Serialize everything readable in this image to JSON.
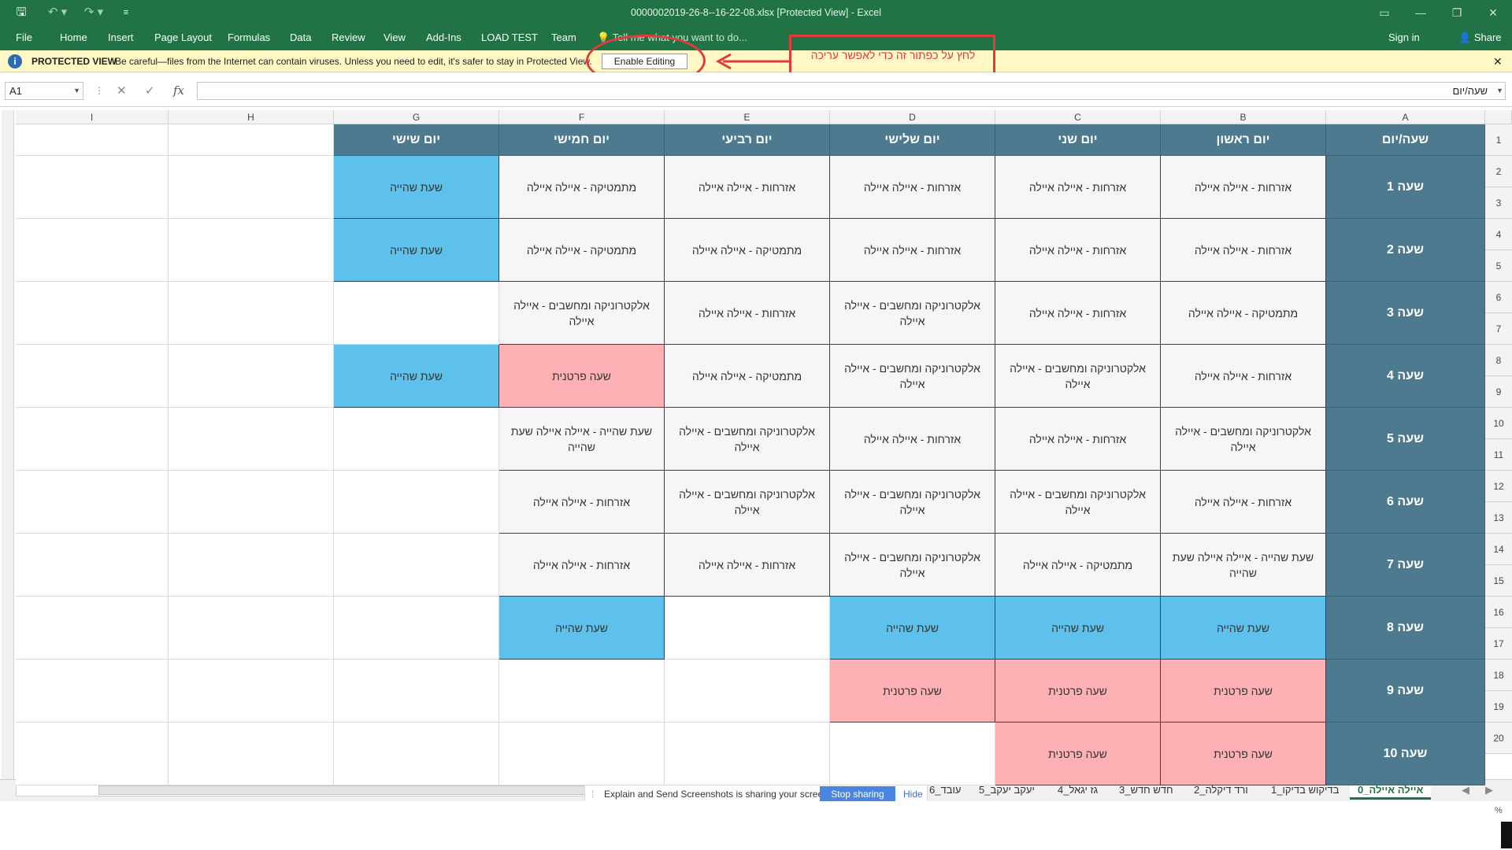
{
  "window": {
    "title": "0000002019-26-8--16-22-08.xlsx  [Protected View] - Excel",
    "controls": [
      "▭",
      "—",
      "❐",
      "✕"
    ]
  },
  "quick_access": {
    "save_icon": "save-icon",
    "undo_icon": "undo-icon",
    "redo_icon": "redo-icon",
    "customize_icon": "customize-icon"
  },
  "ribbon": {
    "tabs": [
      "File",
      "Home",
      "Insert",
      "Page Layout",
      "Formulas",
      "Data",
      "Review",
      "View",
      "Add-Ins",
      "LOAD TEST",
      "Team"
    ],
    "tell_me": "Tell me what you want to do...",
    "sign_in": "Sign in",
    "share": "Share"
  },
  "protected_view": {
    "title": "PROTECTED VIEW",
    "message": "Be careful—files from the Internet can contain viruses. Unless you need to edit, it's safer to stay in Protected View.",
    "enable_button": "Enable Editing",
    "close": "✕",
    "annotation": "לחץ על כפתור זה כדי לאפשר עריכה"
  },
  "formula_bar": {
    "name_box": "A1",
    "formula_value": "שעה/יום",
    "fx": "fx",
    "cancel": "✕",
    "enter": "✓"
  },
  "grid": {
    "column_letters": [
      "A",
      "B",
      "C",
      "D",
      "E",
      "F",
      "G",
      "H",
      "I"
    ],
    "row_numbers": [
      "1",
      "2",
      "3",
      "4",
      "5",
      "6",
      "7",
      "8",
      "9",
      "10",
      "11",
      "12",
      "13",
      "14",
      "15",
      "16",
      "17",
      "18",
      "19",
      "20"
    ],
    "headers": [
      "שעה/יום",
      "יום ראשון",
      "יום שני",
      "יום שלישי",
      "יום רביעי",
      "יום חמישי",
      "יום שישי"
    ],
    "periods": [
      {
        "time": "שעה 1",
        "cells": [
          {
            "text": "אזרחות - איילה איילה",
            "style": "norm"
          },
          {
            "text": "אזרחות - איילה איילה",
            "style": "norm"
          },
          {
            "text": "אזרחות - איילה איילה",
            "style": "norm"
          },
          {
            "text": "אזרחות - איילה איילה",
            "style": "norm"
          },
          {
            "text": "מתמטיקה - איילה איילה",
            "style": "norm"
          },
          {
            "text": "שעת שהייה",
            "style": "blue"
          }
        ]
      },
      {
        "time": "שעה 2",
        "cells": [
          {
            "text": "אזרחות - איילה איילה",
            "style": "norm"
          },
          {
            "text": "אזרחות - איילה איילה",
            "style": "norm"
          },
          {
            "text": "אזרחות - איילה איילה",
            "style": "norm"
          },
          {
            "text": "מתמטיקה - איילה איילה",
            "style": "norm"
          },
          {
            "text": "מתמטיקה - איילה איילה",
            "style": "norm"
          },
          {
            "text": "שעת שהייה",
            "style": "blue"
          }
        ]
      },
      {
        "time": "שעה 3",
        "cells": [
          {
            "text": "מתמטיקה - איילה איילה",
            "style": "norm"
          },
          {
            "text": "אזרחות - איילה איילה",
            "style": "norm"
          },
          {
            "text": "אלקטרוניקה ומחשבים - איילה איילה",
            "style": "norm"
          },
          {
            "text": "אזרחות - איילה איילה",
            "style": "norm"
          },
          {
            "text": "אלקטרוניקה ומחשבים - איילה איילה",
            "style": "norm"
          },
          {
            "text": "",
            "style": "empty"
          }
        ]
      },
      {
        "time": "שעה 4",
        "cells": [
          {
            "text": "אזרחות - איילה איילה",
            "style": "norm"
          },
          {
            "text": "אלקטרוניקה ומחשבים - איילה איילה",
            "style": "norm"
          },
          {
            "text": "אלקטרוניקה ומחשבים - איילה איילה",
            "style": "norm"
          },
          {
            "text": "מתמטיקה - איילה איילה",
            "style": "norm"
          },
          {
            "text": "שעה פרטנית",
            "style": "pink"
          },
          {
            "text": "שעת שהייה",
            "style": "blue"
          }
        ]
      },
      {
        "time": "שעה 5",
        "cells": [
          {
            "text": "אלקטרוניקה ומחשבים - איילה איילה",
            "style": "norm"
          },
          {
            "text": "אזרחות - איילה איילה",
            "style": "norm"
          },
          {
            "text": "אזרחות - איילה איילה",
            "style": "norm"
          },
          {
            "text": "אלקטרוניקה ומחשבים - איילה איילה",
            "style": "norm"
          },
          {
            "text": "שעת שהייה - איילה איילה שעת שהייה",
            "style": "norm"
          },
          {
            "text": "",
            "style": "empty"
          }
        ]
      },
      {
        "time": "שעה 6",
        "cells": [
          {
            "text": "אזרחות - איילה איילה",
            "style": "norm"
          },
          {
            "text": "אלקטרוניקה ומחשבים - איילה איילה",
            "style": "norm"
          },
          {
            "text": "אלקטרוניקה ומחשבים - איילה איילה",
            "style": "norm"
          },
          {
            "text": "אלקטרוניקה ומחשבים - איילה איילה",
            "style": "norm"
          },
          {
            "text": "אזרחות - איילה איילה",
            "style": "norm"
          },
          {
            "text": "",
            "style": "empty"
          }
        ]
      },
      {
        "time": "שעה 7",
        "cells": [
          {
            "text": "שעת שהייה - איילה איילה שעת שהייה",
            "style": "norm"
          },
          {
            "text": "מתמטיקה - איילה איילה",
            "style": "norm"
          },
          {
            "text": "אלקטרוניקה ומחשבים - איילה איילה",
            "style": "norm"
          },
          {
            "text": "אזרחות - איילה איילה",
            "style": "norm"
          },
          {
            "text": "אזרחות - איילה איילה",
            "style": "norm"
          },
          {
            "text": "",
            "style": "empty"
          }
        ]
      },
      {
        "time": "שעה 8",
        "cells": [
          {
            "text": "שעת שהייה",
            "style": "blue"
          },
          {
            "text": "שעת שהייה",
            "style": "blue"
          },
          {
            "text": "שעת שהייה",
            "style": "blue"
          },
          {
            "text": "",
            "style": "empty"
          },
          {
            "text": "שעת שהייה",
            "style": "blue"
          },
          {
            "text": "",
            "style": "empty"
          }
        ]
      },
      {
        "time": "שעה 9",
        "cells": [
          {
            "text": "שעה פרטנית",
            "style": "pink"
          },
          {
            "text": "שעה פרטנית",
            "style": "pink"
          },
          {
            "text": "שעה פרטנית",
            "style": "pink"
          },
          {
            "text": "",
            "style": "empty"
          },
          {
            "text": "",
            "style": "empty"
          },
          {
            "text": "",
            "style": "empty"
          }
        ]
      },
      {
        "time": "שעה 10",
        "cells": [
          {
            "text": "שעה פרטנית",
            "style": "pink"
          },
          {
            "text": "שעה פרטנית",
            "style": "pink"
          },
          {
            "text": "",
            "style": "empty"
          },
          {
            "text": "",
            "style": "empty"
          },
          {
            "text": "",
            "style": "empty"
          },
          {
            "text": "",
            "style": "empty"
          }
        ]
      }
    ]
  },
  "sheets": {
    "tabs": [
      "0_איילה איילה",
      "1_בדיקוש בדיקו",
      "2_ורד דיקלה",
      "3_חדש חדש",
      "4_גז יגאל",
      "5_יעקב יעקב",
      "6_עובד"
    ],
    "active_index": 0,
    "nav_prev": "◀",
    "nav_next": "▶"
  },
  "share_bar": {
    "message": "Explain and Send Screenshots is sharing your screen.",
    "stop": "Stop sharing",
    "hide": "Hide"
  },
  "colors": {
    "excel_green": "#217346",
    "header_teal": "#4e7a90",
    "blue_cell": "#5ec1ec",
    "pink_cell": "#fdb1b4",
    "annotation_red": "#e23b3b"
  }
}
